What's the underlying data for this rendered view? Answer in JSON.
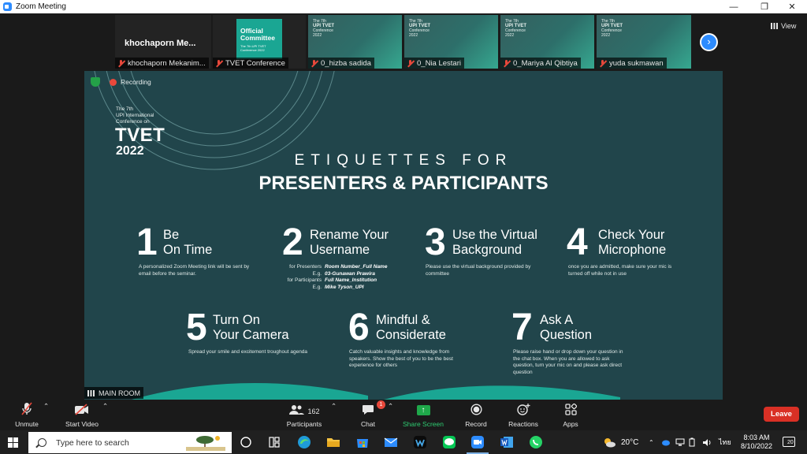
{
  "window": {
    "title": "Zoom Meeting"
  },
  "thumbnails": [
    {
      "name": "khochaporn Mekanim...",
      "display_name": "khochaporn Me...",
      "kind": "black"
    },
    {
      "name": "TVET Conference",
      "card_title": "Official Committee",
      "card_sub": "The 7th UPI TVET Conference 2022",
      "kind": "green-card"
    },
    {
      "name": "0_hizba sadida",
      "kind": "slide"
    },
    {
      "name": "0_Nia Lestari",
      "kind": "slide"
    },
    {
      "name": "0_Mariya Al Qibtiya",
      "kind": "slide"
    },
    {
      "name": "yuda sukmawan",
      "kind": "slide"
    }
  ],
  "thumb_mini_text": {
    "line1": "The 7th",
    "line2": "UPI TVET",
    "line3": "Conference",
    "line4": "2022"
  },
  "view_button": "View",
  "next_icon": "chevron-right-icon",
  "share": {
    "recording_label": "Recording",
    "conf_line1": "The 7th",
    "conf_line2": "UPI International",
    "conf_line3": "Conference on",
    "conf_name": "TVET",
    "conf_year": "2022",
    "heading1": "ETIQUETTES FOR",
    "heading2": "PRESENTERS & PARTICIPANTS",
    "items": [
      {
        "num": "1",
        "title1": "Be",
        "title2": "On Time",
        "desc": "A personalized Zoom Meeting link will be sent by email before the seminar."
      },
      {
        "num": "2",
        "title1": "Rename Your",
        "title2": "Username",
        "rows": [
          {
            "k": "for Presenters",
            "v": "Room Number_Full Name"
          },
          {
            "k": "E.g.",
            "v": "03-Gunawan Prawira"
          },
          {
            "k": "for Participants",
            "v": "Full Name_Institution"
          },
          {
            "k": "E.g.",
            "v": "Mike Tyson_UPI"
          }
        ]
      },
      {
        "num": "3",
        "title1": "Use the Virtual",
        "title2": "Background",
        "desc": "Please use the virtual background provided by committee"
      },
      {
        "num": "4",
        "title1": "Check Your",
        "title2": "Microphone",
        "desc": "once you are admitted, make sure your mic is turned off while not in use"
      },
      {
        "num": "5",
        "title1": "Turn On",
        "title2": "Your Camera",
        "desc": "Spread your smile and excitement troughout agenda"
      },
      {
        "num": "6",
        "title1": "Mindful &",
        "title2": "Considerate",
        "desc": "Catch valuable insights and knowledge from speakers. Show the best of you to be the best experience for others"
      },
      {
        "num": "7",
        "title1": "Ask A",
        "title2": "Question",
        "desc": "Please raise hand or drop down your question in the chat box. When you are allowed to ask question, turn your mic on and please ask direct question"
      }
    ]
  },
  "room_label": "MAIN ROOM",
  "toolbar": {
    "unmute": "Unmute",
    "start_video": "Start Video",
    "participants": "Participants",
    "participants_count": "162",
    "chat": "Chat",
    "chat_badge": "1",
    "share_screen": "Share Screen",
    "record": "Record",
    "reactions": "Reactions",
    "apps": "Apps",
    "leave": "Leave"
  },
  "taskbar": {
    "search_placeholder": "Type here to search",
    "temperature": "20°C",
    "lang": "ไทย",
    "time": "8:03 AM",
    "date": "8/10/2022",
    "notif_count": "20"
  },
  "colors": {
    "accent": "#2d8cff",
    "leave": "#d93025",
    "share_green": "#1fa84a",
    "slide_bg": "#21454b"
  }
}
